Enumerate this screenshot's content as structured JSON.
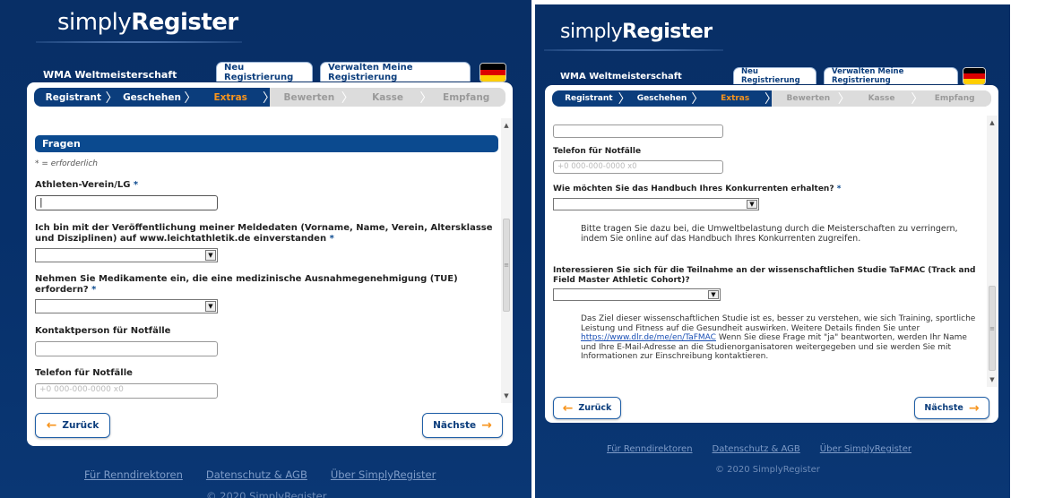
{
  "brand": {
    "thin": "simply",
    "bold": "Register"
  },
  "event_title": "WMA Weltmeisterschaft",
  "tabs": {
    "new": "Neu Registrierung",
    "manage": "Verwalten Meine Registrierung"
  },
  "steps": [
    "Registrant",
    "Geschehen",
    "Extras",
    "Bewerten",
    "Kasse",
    "Empfang"
  ],
  "colors": {
    "brand_dark": "#082f66",
    "accent": "#f7941d",
    "step_active": "#0b3d7c",
    "section_head": "#0b4a8f"
  },
  "icons": {
    "flag": "germany-flag-icon",
    "back": "arrow-left-icon",
    "next": "arrow-right-icon"
  },
  "left": {
    "section_title": "Fragen",
    "required_note": "* = erforderlich",
    "q_club": "Athleten-Verein/LG",
    "q_publish": "Ich bin mit der Veröffentlichung meiner Meldedaten (Vorname, Name, Verein, Altersklasse und Disziplinen) auf www.leichtathletik.de einverstanden",
    "q_tue": "Nehmen Sie Medikamente ein, die eine medizinische Ausnahmegenehmigung (TUE) erfordern?",
    "q_contact": "Kontaktperson für Notfälle",
    "q_phone": "Telefon für Notfälle",
    "phone_placeholder": "+0 000-000-0000 x0"
  },
  "right": {
    "q_phone": "Telefon für Notfälle",
    "phone_placeholder": "+0 000-000-0000 x0",
    "q_handbook": "Wie möchten Sie das Handbuch Ihres Konkurrenten erhalten?",
    "handbook_info": "Bitte tragen Sie dazu bei, die Umweltbelastung durch die Meisterschaften zu verringern, indem Sie online auf das Handbuch Ihres Konkurrenten zugreifen.",
    "q_study": "Interessieren Sie sich für die Teilnahme an der wissenschaftlichen Studie TaFMAC (Track and Field Master Athletic Cohort)?",
    "study_info_1": "Das Ziel dieser wissenschaftlichen Studie ist es, besser zu verstehen, wie sich Training, sportliche Leistung und Fitness auf die Gesundheit auswirken. Weitere Details finden Sie unter",
    "study_link": "https://www.dlr.de/me/en/TaFMAC",
    "study_info_2": "Wenn Sie diese Frage mit \"ja\" beantworten, werden Ihr Name und Ihre E-Mail-Adresse an die Studienorganisatoren weitergegeben und sie werden Sie mit Informationen zur Einschreibung kontaktieren."
  },
  "required_mark": "*",
  "buttons": {
    "back": "Zurück",
    "next": "Nächste"
  },
  "footer": {
    "link1": "Für Renndirektoren",
    "link2": "Datenschutz & AGB",
    "link3": "Über SimplyRegister",
    "copyright": "© 2020 SimplyRegister"
  }
}
